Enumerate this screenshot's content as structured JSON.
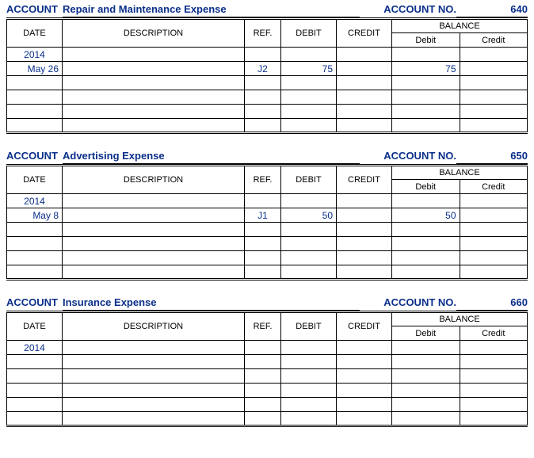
{
  "labels": {
    "account": "ACCOUNT",
    "account_no": "ACCOUNT NO.",
    "balance": "BALANCE",
    "date": "DATE",
    "description": "DESCRIPTION",
    "ref": "REF.",
    "debit": "DEBIT",
    "credit": "CREDIT",
    "bal_debit": "Debit",
    "bal_credit": "Credit"
  },
  "ledgers": [
    {
      "name": "Repair and Maintenance Expense",
      "number": "640",
      "year": "2014",
      "rows": [
        {
          "date": "May 26",
          "desc": "",
          "ref": "J2",
          "debit": "75",
          "credit": "",
          "bal_debit": "75",
          "bal_credit": ""
        },
        {
          "date": "",
          "desc": "",
          "ref": "",
          "debit": "",
          "credit": "",
          "bal_debit": "",
          "bal_credit": ""
        },
        {
          "date": "",
          "desc": "",
          "ref": "",
          "debit": "",
          "credit": "",
          "bal_debit": "",
          "bal_credit": ""
        },
        {
          "date": "",
          "desc": "",
          "ref": "",
          "debit": "",
          "credit": "",
          "bal_debit": "",
          "bal_credit": ""
        },
        {
          "date": "",
          "desc": "",
          "ref": "",
          "debit": "",
          "credit": "",
          "bal_debit": "",
          "bal_credit": ""
        }
      ]
    },
    {
      "name": "Advertising Expense",
      "number": "650",
      "year": "2014",
      "rows": [
        {
          "date": "May 8",
          "desc": "",
          "ref": "J1",
          "debit": "50",
          "credit": "",
          "bal_debit": "50",
          "bal_credit": ""
        },
        {
          "date": "",
          "desc": "",
          "ref": "",
          "debit": "",
          "credit": "",
          "bal_debit": "",
          "bal_credit": ""
        },
        {
          "date": "",
          "desc": "",
          "ref": "",
          "debit": "",
          "credit": "",
          "bal_debit": "",
          "bal_credit": ""
        },
        {
          "date": "",
          "desc": "",
          "ref": "",
          "debit": "",
          "credit": "",
          "bal_debit": "",
          "bal_credit": ""
        },
        {
          "date": "",
          "desc": "",
          "ref": "",
          "debit": "",
          "credit": "",
          "bal_debit": "",
          "bal_credit": ""
        }
      ]
    },
    {
      "name": "Insurance Expense",
      "number": "660",
      "year": "2014",
      "rows": [
        {
          "date": "",
          "desc": "",
          "ref": "",
          "debit": "",
          "credit": "",
          "bal_debit": "",
          "bal_credit": ""
        },
        {
          "date": "",
          "desc": "",
          "ref": "",
          "debit": "",
          "credit": "",
          "bal_debit": "",
          "bal_credit": ""
        },
        {
          "date": "",
          "desc": "",
          "ref": "",
          "debit": "",
          "credit": "",
          "bal_debit": "",
          "bal_credit": ""
        },
        {
          "date": "",
          "desc": "",
          "ref": "",
          "debit": "",
          "credit": "",
          "bal_debit": "",
          "bal_credit": ""
        },
        {
          "date": "",
          "desc": "",
          "ref": "",
          "debit": "",
          "credit": "",
          "bal_debit": "",
          "bal_credit": ""
        }
      ]
    }
  ]
}
